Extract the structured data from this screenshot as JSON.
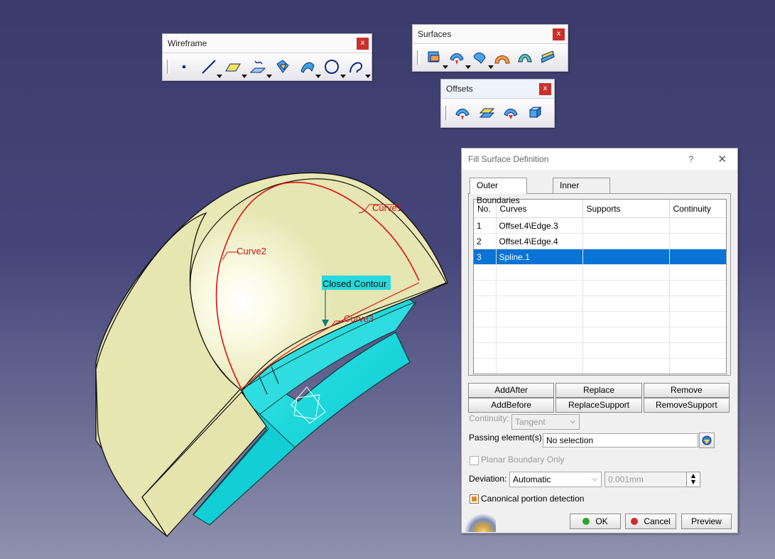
{
  "viewport": {
    "labels": {
      "curve1": "Curve1",
      "curve2": "Curve2",
      "curve3": "Curve3",
      "closed_contour": "Closed Contour"
    }
  },
  "toolbars": {
    "wireframe": {
      "title": "Wireframe",
      "close": "x",
      "icons": [
        "point-icon",
        "line-icon",
        "plane-icon",
        "projection-icon",
        "intersection-icon",
        "parallel-curve-icon",
        "circle-icon",
        "spline-icon"
      ]
    },
    "surfaces": {
      "title": "Surfaces",
      "close": "x",
      "icons": [
        "extrude-icon",
        "offset-surface-icon",
        "sweep-icon",
        "fill-icon",
        "multi-section-icon",
        "blend-icon"
      ]
    },
    "offsets": {
      "title": "Offsets",
      "close": "x",
      "icons": [
        "offset-icon",
        "variable-offset-icon",
        "rough-offset-icon",
        "thickness-icon"
      ]
    }
  },
  "dialog": {
    "title": "Fill Surface Definition",
    "help": "?",
    "close": "✕",
    "tabs": [
      "Outer Boundaries",
      "Inner Boundaries"
    ],
    "table": {
      "headers": [
        "No.",
        "Curves",
        "Supports",
        "Continuity"
      ],
      "rows": [
        {
          "no": "1",
          "curve": "Offset.4\\Edge.3",
          "support": "",
          "continuity": ""
        },
        {
          "no": "2",
          "curve": "Offset.4\\Edge.4",
          "support": "",
          "continuity": ""
        },
        {
          "no": "3",
          "curve": "Spline.1",
          "support": "",
          "continuity": ""
        }
      ],
      "selected_row": 3
    },
    "buttons": {
      "add_after": "AddAfter",
      "replace": "Replace",
      "remove": "Remove",
      "add_before": "AddBefore",
      "replace_support": "ReplaceSupport",
      "remove_support": "RemoveSupport"
    },
    "continuity_label": "Continuity:",
    "continuity_value": "Tangent",
    "passing_label": "Passing element(s):",
    "passing_value": "No selection",
    "planar_label": "Planar Boundary Only",
    "deviation_label": "Deviation:",
    "deviation_mode": "Automatic",
    "deviation_value": "0.001mm",
    "canonical_label": "Canonical portion detection",
    "ok": "OK",
    "cancel": "Cancel",
    "preview": "Preview",
    "colors": {
      "selection": "#0a73d6",
      "ok_dot": "#2aa52a",
      "cancel_dot": "#d42a2a"
    }
  }
}
